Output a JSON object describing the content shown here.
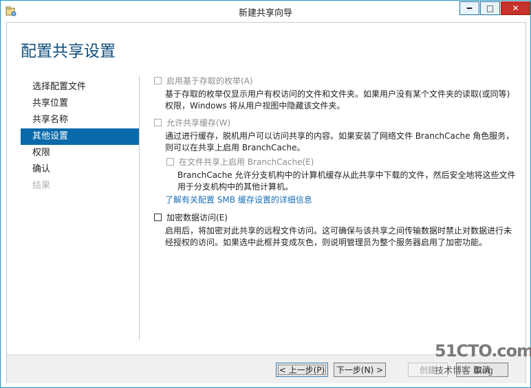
{
  "window": {
    "title": "新建共享向导",
    "min_label": "━",
    "max_label": "□",
    "close_label": "✕"
  },
  "page": {
    "title": "配置共享设置"
  },
  "nav": {
    "items": [
      {
        "label": "选择配置文件"
      },
      {
        "label": "共享位置"
      },
      {
        "label": "共享名称"
      },
      {
        "label": "其他设置"
      },
      {
        "label": "权限"
      },
      {
        "label": "确认"
      },
      {
        "label": "结果"
      }
    ],
    "active_index": 3
  },
  "options": {
    "abe": {
      "label": "启用基于存取的枚举(A)",
      "checked": false,
      "enabled": false,
      "description": "基于存取的枚举仅显示用户有权访问的文件和文件夹。如果用户没有某个文件夹的读取(或同等)权限，Windows 将从用户视图中隐藏该文件夹。"
    },
    "caching": {
      "label": "允许共享缓存(W)",
      "checked": false,
      "enabled": false,
      "description": "通过进行缓存，脱机用户可以访问共享的内容。如果安装了网络文件 BranchCache 角色服务，则可以在共享上启用 BranchCache。"
    },
    "branchcache": {
      "label": "在文件共享上启用 BranchCache(E)",
      "checked": false,
      "enabled": false,
      "description": "BranchCache 允许分支机构中的计算机缓存从此共享中下载的文件，然后安全地将这些文件用于分支机构中的其他计算机。"
    },
    "smb_link": "了解有关配置 SMB 缓存设置的详细信息",
    "encrypt": {
      "label": "加密数据访问(E)",
      "checked": false,
      "enabled": true,
      "description": "启用后，将加密对此共享的远程文件访问。这可确保与该共享之间传输数据时禁止对数据进行未经授权的访问。如果选中此框并变成灰色，则说明管理员为整个服务器启用了加密功能。"
    }
  },
  "footer": {
    "back": "< 上一步(P)",
    "next": "下一步(N) >",
    "create": "创建",
    "cancel": "取消"
  },
  "watermark": {
    "line1": "51CTO.com",
    "line2": "技术博客 Blog"
  }
}
